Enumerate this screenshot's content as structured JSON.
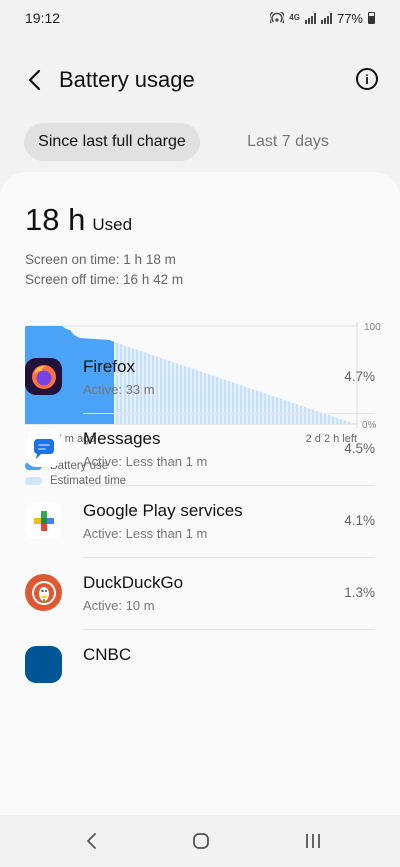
{
  "status_bar": {
    "time": "19:12",
    "network": "4G",
    "battery_percent": "77%"
  },
  "header": {
    "title": "Battery usage",
    "back_icon": "back-arrow-icon",
    "info_icon": "info-icon"
  },
  "tabs": [
    {
      "label": "Since last full charge",
      "active": true
    },
    {
      "label": "Last 7 days",
      "active": false
    }
  ],
  "summary": {
    "used_value": "18 h",
    "used_label": "Used",
    "screen_on": "Screen on time: 1 h 18 m",
    "screen_off": "Screen off time: 16 h 42 m"
  },
  "chart": {
    "y_top_label": "100",
    "y_bottom_label": "0%",
    "x_left_label": "18 h 37 m ago",
    "x_right_label": "2 d 2 h left",
    "legend": [
      {
        "label": "Battery use",
        "color": "#4aa3f7"
      },
      {
        "label": "Estimated time",
        "color": "#cfe6fb"
      }
    ]
  },
  "apps": [
    {
      "name": "Firefox",
      "active": "Active: 33 m",
      "percent": "4.7%",
      "icon": "firefox-icon"
    },
    {
      "name": "Messages",
      "active": "Active: Less than 1 m",
      "percent": "4.5%",
      "icon": "messages-icon"
    },
    {
      "name": "Google Play services",
      "active": "Active: Less than 1 m",
      "percent": "4.1%",
      "icon": "google-play-services-icon"
    },
    {
      "name": "DuckDuckGo",
      "active": "Active: 10 m",
      "percent": "1.3%",
      "icon": "duckduckgo-icon"
    },
    {
      "name": "CNBC",
      "active": "",
      "percent": "",
      "icon": "cnbc-icon"
    }
  ],
  "nav": {
    "back": "back-nav-icon",
    "home": "home-nav-icon",
    "recents": "recents-nav-icon"
  }
}
